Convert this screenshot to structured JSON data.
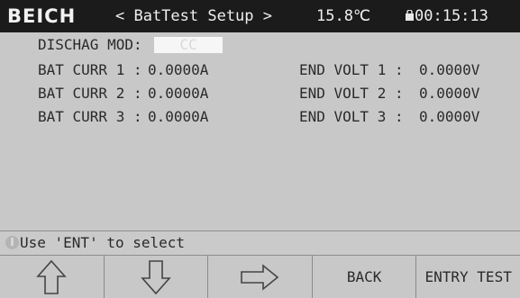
{
  "header": {
    "brand": "BEICH",
    "title": "< BatTest Setup >",
    "temperature": "15.8℃",
    "time": "00:15:13",
    "lock_icon": "lock-icon"
  },
  "setup": {
    "mode_label": "DISCHAG MOD:",
    "mode_value": "CC",
    "rows": [
      {
        "curr_label": "BAT CURR 1 :",
        "curr_value": "0.0000A",
        "volt_label": "END VOLT 1 :",
        "volt_value": "0.0000V"
      },
      {
        "curr_label": "BAT CURR 2 :",
        "curr_value": "0.0000A",
        "volt_label": "END VOLT 2 :",
        "volt_value": "0.0000V"
      },
      {
        "curr_label": "BAT CURR 3 :",
        "curr_value": "0.0000A",
        "volt_label": "END VOLT 3 :",
        "volt_value": "0.0000V"
      }
    ]
  },
  "status": {
    "message": "Use 'ENT' to select",
    "icon": "info-icon"
  },
  "softkeys": [
    {
      "name": "up-arrow-icon",
      "label": ""
    },
    {
      "name": "down-arrow-icon",
      "label": ""
    },
    {
      "name": "right-arrow-icon",
      "label": ""
    },
    {
      "name": "back",
      "label": "BACK"
    },
    {
      "name": "entry-test",
      "label": "ENTRY TEST"
    }
  ]
}
